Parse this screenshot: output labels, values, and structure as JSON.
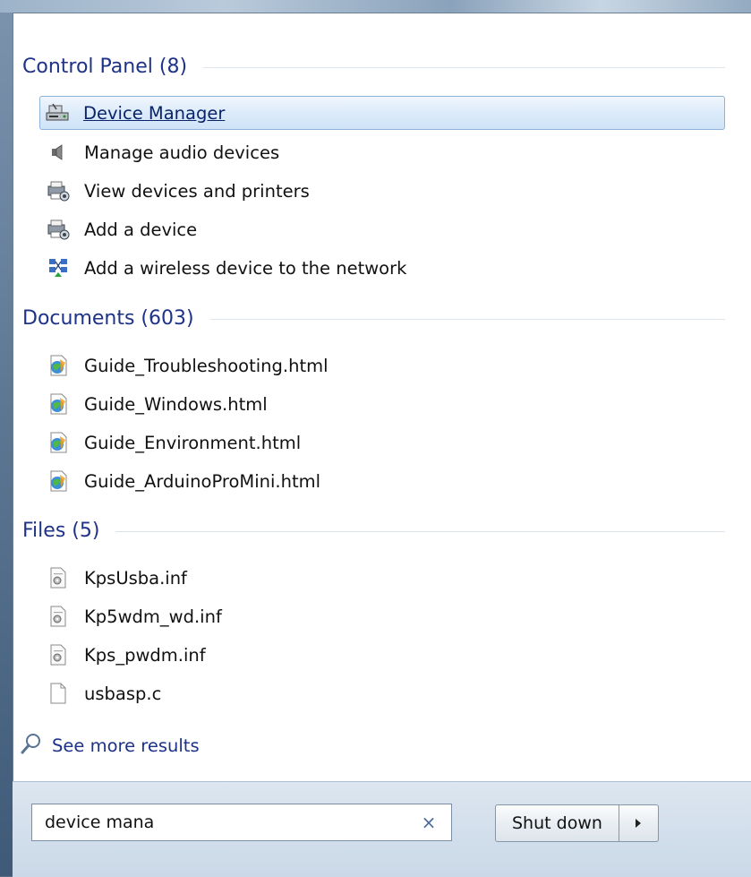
{
  "sections": {
    "control_panel": {
      "title": "Control Panel (8)",
      "items": [
        {
          "label": "Device Manager",
          "icon": "device-manager-icon"
        },
        {
          "label": "Manage audio devices",
          "icon": "speaker-icon"
        },
        {
          "label": "View devices and printers",
          "icon": "printer-icon"
        },
        {
          "label": "Add a device",
          "icon": "printer-icon"
        },
        {
          "label": "Add a wireless device to the network",
          "icon": "network-icon"
        }
      ]
    },
    "documents": {
      "title": "Documents (603)",
      "items": [
        {
          "label": "Guide_Troubleshooting.html",
          "icon": "html-file-icon"
        },
        {
          "label": "Guide_Windows.html",
          "icon": "html-file-icon"
        },
        {
          "label": "Guide_Environment.html",
          "icon": "html-file-icon"
        },
        {
          "label": "Guide_ArduinoProMini.html",
          "icon": "html-file-icon"
        }
      ]
    },
    "files": {
      "title": "Files (5)",
      "items": [
        {
          "label": "KpsUsba.inf",
          "icon": "inf-file-icon"
        },
        {
          "label": "Kp5wdm_wd.inf",
          "icon": "inf-file-icon"
        },
        {
          "label": "Kps_pwdm.inf",
          "icon": "inf-file-icon"
        },
        {
          "label": "usbasp.c",
          "icon": "blank-file-icon"
        }
      ]
    }
  },
  "see_more": {
    "label": "See more results"
  },
  "search": {
    "value": "device mana",
    "clear_glyph": "×"
  },
  "shutdown": {
    "label": "Shut down"
  },
  "colors": {
    "section_title": "#1e3287",
    "selection": "#dcebfa",
    "link": "#1e3287"
  }
}
